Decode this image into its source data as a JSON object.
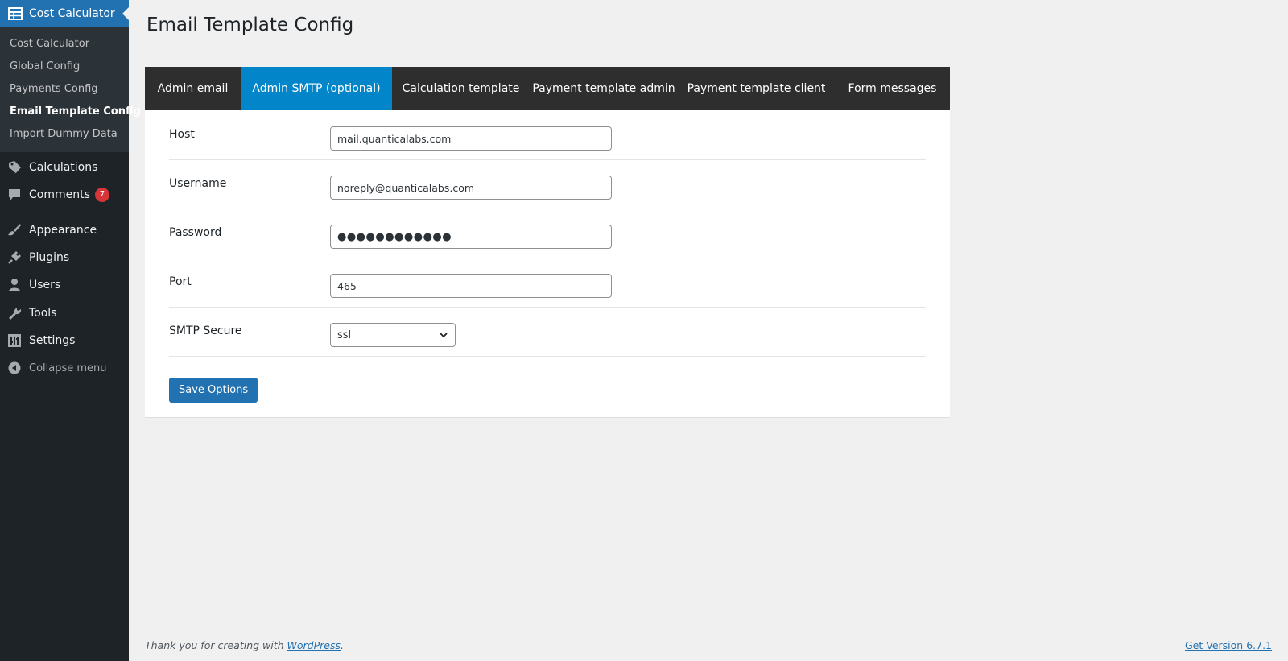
{
  "page": {
    "title": "Email Template Config"
  },
  "sidebar": {
    "plugin_label": "Cost Calculator",
    "submenu": [
      "Cost Calculator",
      "Global Config",
      "Payments Config",
      "Email Template Config",
      "Import Dummy Data"
    ],
    "items": {
      "calculations": "Calculations",
      "comments": "Comments",
      "comments_count": "7",
      "appearance": "Appearance",
      "plugins": "Plugins",
      "users": "Users",
      "tools": "Tools",
      "settings": "Settings",
      "collapse": "Collapse menu"
    }
  },
  "tabs": [
    "Admin email",
    "Admin SMTP (optional)",
    "Calculation template",
    "Payment template admin",
    "Payment template client",
    "Form messages"
  ],
  "active_tab": 1,
  "form": {
    "host_label": "Host",
    "host_value": "mail.quanticalabs.com",
    "username_label": "Username",
    "username_value": "noreply@quanticalabs.com",
    "password_label": "Password",
    "password_value": "●●●●●●●●●●●●",
    "port_label": "Port",
    "port_value": "465",
    "secure_label": "SMTP Secure",
    "secure_value": "ssl",
    "save_label": "Save Options"
  },
  "footer": {
    "thanks_prefix": "Thank you for creating with ",
    "wordpress_link": "WordPress",
    "thanks_suffix": ".",
    "version_link": "Get Version 6.7.1"
  },
  "colors": {
    "accent": "#2271b1",
    "active_tab": "#0385c9",
    "sidebar_bg": "#1d2327",
    "badge": "#d63638"
  }
}
